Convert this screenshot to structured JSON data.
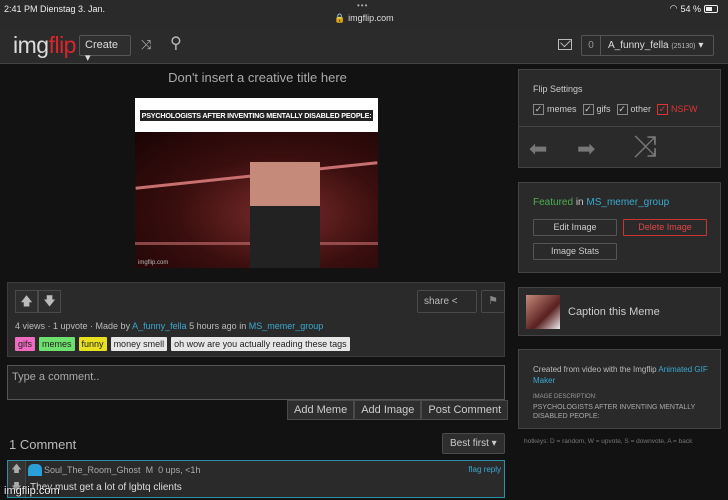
{
  "statusbar": {
    "time": "2:41 PM",
    "date": "Dienstag 3. Jan.",
    "url": "imgflip.com",
    "battery": "54 %",
    "battery_level": 0.54
  },
  "nav": {
    "logo_img": "img",
    "logo_flip": "flip",
    "create": "Create ▾",
    "shuffle_icon": "⤨",
    "search_icon": "⚲",
    "notif_count": "0",
    "username": "A_funny_fella",
    "points": "(25130)",
    "dropdown": "▾"
  },
  "meme": {
    "title": "Don't insert a creative title here",
    "caption": "PSYCHOLOGISTS AFTER INVENTING MENTALLY DISABLED PEOPLE:",
    "watermark": "imgflip.com"
  },
  "actions": {
    "upvote": "🡅",
    "downvote": "🡇",
    "share": "share",
    "flag": "⚑",
    "views": "4 views",
    "upvotes": "1 upvote",
    "made_by": "Made by",
    "author": "A_funny_fella",
    "time_ago": "5 hours ago in",
    "stream": "MS_memer_group",
    "tags": [
      {
        "label": "gifs",
        "color": "#f06ac0"
      },
      {
        "label": "memes",
        "color": "#6ee06e"
      },
      {
        "label": "funny",
        "color": "#e8e020"
      },
      {
        "label": "money smell",
        "color": "#e6e6e6"
      },
      {
        "label": "oh wow are you actually reading these tags",
        "color": "#e6e6e6"
      }
    ]
  },
  "comment_form": {
    "placeholder": "Type a comment..",
    "add_meme": "Add Meme",
    "add_image": "Add Image",
    "post": "Post Comment"
  },
  "comments": {
    "count": "1 Comment",
    "sort": "Best first ▾",
    "items": [
      {
        "user": "Soul_The_Room_Ghost",
        "badge": "M",
        "stats": "0 ups, <1h",
        "text": "They must get a lot of lgbtq clients",
        "flag": "flag",
        "reply": "reply"
      }
    ]
  },
  "bottom_watermark": "imgflip.com",
  "sidebar": {
    "flip": {
      "title": "Flip Settings",
      "options": [
        {
          "label": "memes",
          "checked": true
        },
        {
          "label": "gifs",
          "checked": true
        },
        {
          "label": "other",
          "checked": true
        },
        {
          "label": "NSFW",
          "checked": true
        }
      ]
    },
    "featured": {
      "label": "Featured",
      "in": "in",
      "stream": "MS_memer_group",
      "edit": "Edit Image",
      "delete": "Delete Image",
      "stats": "Image Stats"
    },
    "caption": {
      "label": "Caption this Meme"
    },
    "info": {
      "created": "Created from video with the Imgflip",
      "link": "Animated GIF Maker",
      "desc_label": "IMAGE DESCRIPTION:",
      "desc": "PSYCHOLOGISTS AFTER INVENTING MENTALLY DISABLED PEOPLE:"
    },
    "hotkeys": "hotkeys: D = random, W = upvote, S = downvote, A = back"
  }
}
